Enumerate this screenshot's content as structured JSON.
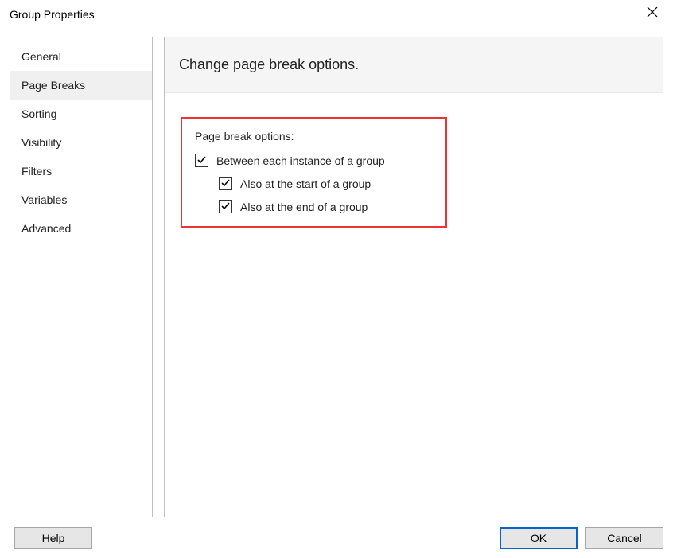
{
  "title": "Group Properties",
  "sidebar": {
    "items": [
      {
        "label": "General"
      },
      {
        "label": "Page Breaks"
      },
      {
        "label": "Sorting"
      },
      {
        "label": "Visibility"
      },
      {
        "label": "Filters"
      },
      {
        "label": "Variables"
      },
      {
        "label": "Advanced"
      }
    ],
    "selected_index": 1
  },
  "panel": {
    "heading": "Change page break options.",
    "options_label": "Page break options:",
    "checkboxes": [
      {
        "label": "Between each instance of a group",
        "checked": true
      },
      {
        "label": "Also at the start of a group",
        "checked": true
      },
      {
        "label": "Also at the end of a group",
        "checked": true
      }
    ]
  },
  "buttons": {
    "help": "Help",
    "ok": "OK",
    "cancel": "Cancel"
  }
}
